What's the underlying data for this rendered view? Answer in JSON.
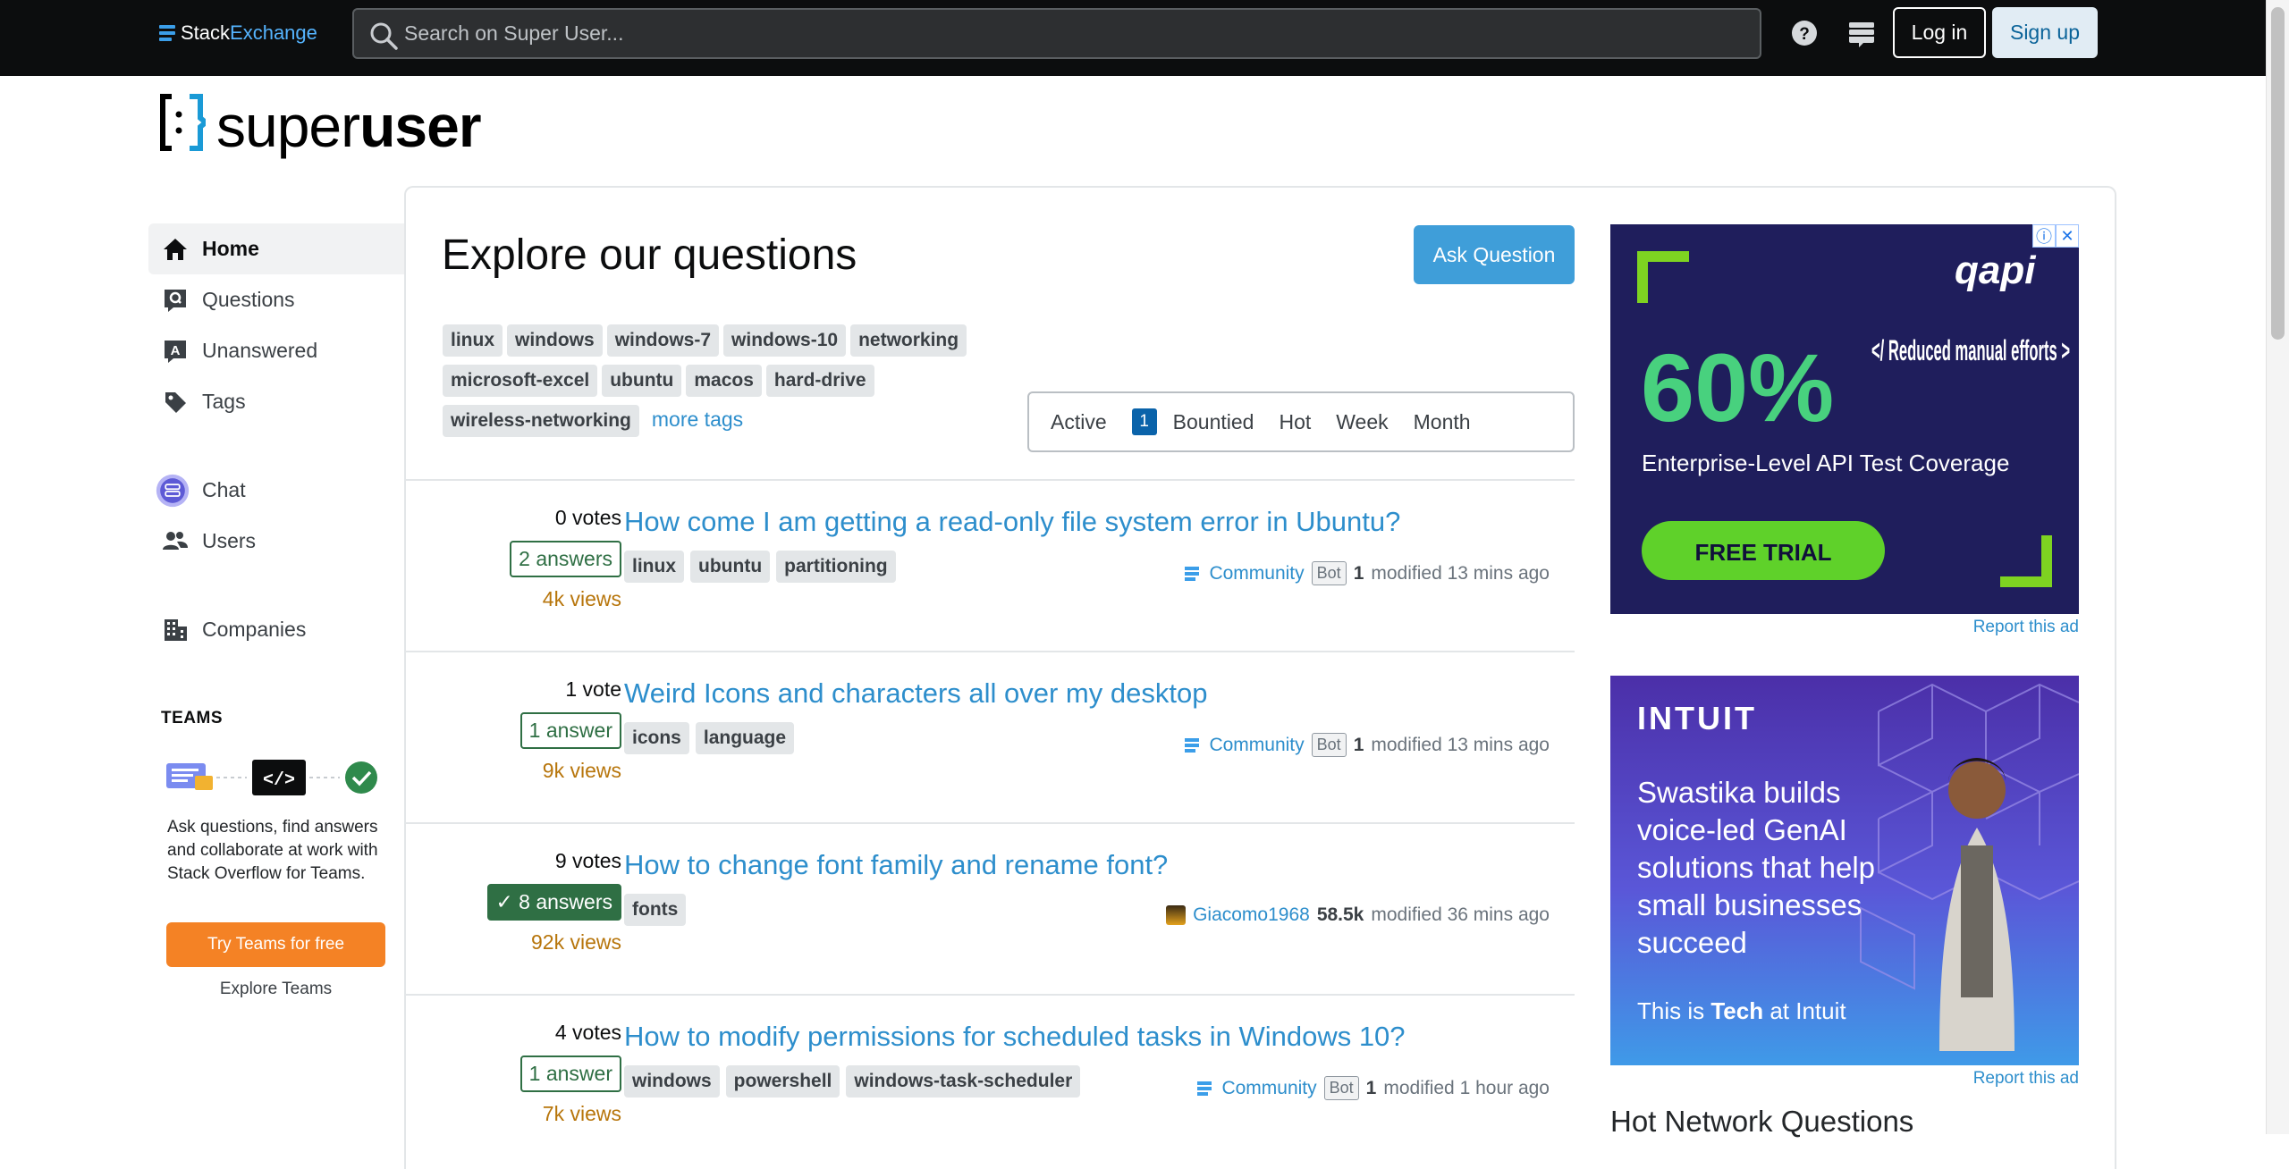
{
  "topbar": {
    "brand_a": "Stack",
    "brand_b": "Exchange",
    "search_placeholder": "Search on Super User...",
    "login_label": "Log in",
    "signup_label": "Sign up"
  },
  "site": {
    "logo_light": "super",
    "logo_bold": "user"
  },
  "sidebar": {
    "items": [
      {
        "label": "Home",
        "icon": "home-icon"
      },
      {
        "label": "Questions",
        "icon": "questions-icon"
      },
      {
        "label": "Unanswered",
        "icon": "unanswered-icon"
      },
      {
        "label": "Tags",
        "icon": "tags-icon"
      },
      {
        "label": "Chat",
        "icon": "chat-icon"
      },
      {
        "label": "Users",
        "icon": "users-icon"
      },
      {
        "label": "Companies",
        "icon": "companies-icon"
      }
    ],
    "teams_title": "TEAMS",
    "teams_desc": "Ask questions, find answers and collaborate at work with Stack Overflow for Teams.",
    "teams_button": "Try Teams for free",
    "teams_explore": "Explore Teams"
  },
  "main": {
    "title": "Explore our questions",
    "ask_button": "Ask Question",
    "tags": [
      "linux",
      "windows",
      "windows-7",
      "windows-10",
      "networking",
      "microsoft-excel",
      "ubuntu",
      "macos",
      "hard-drive",
      "wireless-networking"
    ],
    "more_tags": "more tags",
    "filters": {
      "active": "Active",
      "bounty_count": "1",
      "bountied": "Bountied",
      "hot": "Hot",
      "week": "Week",
      "month": "Month"
    },
    "questions": [
      {
        "votes": "0 votes",
        "answers": "2 answers",
        "views": "4k views",
        "title": "How come I am getting a read-only file system error in Ubuntu?",
        "tags": [
          "linux",
          "ubuntu",
          "partitioning"
        ],
        "user": "Community",
        "bot": "Bot",
        "rep": "1",
        "modified": "modified 13 mins ago"
      },
      {
        "votes": "1 vote",
        "answers": "1 answer",
        "views": "9k views",
        "title": "Weird Icons and characters all over my desktop",
        "tags": [
          "icons",
          "language"
        ],
        "user": "Community",
        "bot": "Bot",
        "rep": "1",
        "modified": "modified 13 mins ago"
      },
      {
        "votes": "9 votes",
        "answers": "8 answers",
        "views": "92k views",
        "title": "How to change font family and rename font?",
        "tags": [
          "fonts"
        ],
        "user": "Giacomo1968",
        "rep": "58.5k",
        "modified": "modified 36 mins ago"
      },
      {
        "votes": "4 votes",
        "answers": "1 answer",
        "views": "7k views",
        "title": "How to modify permissions for scheduled tasks in Windows 10?",
        "tags": [
          "windows",
          "powershell",
          "windows-task-scheduler"
        ],
        "user": "Community",
        "bot": "Bot",
        "rep": "1",
        "modified": "modified 1 hour ago"
      }
    ]
  },
  "rail": {
    "ad1": {
      "brand": "qapi",
      "big": "60%",
      "tagline": "</ Reduced manual efforts >",
      "subline": "Enterprise-Level API Test Coverage",
      "cta": "FREE TRIAL"
    },
    "report_label": "Report this ad",
    "ad2": {
      "brand": "INTUIT",
      "line1": "Swastika builds",
      "line2": "voice-led GenAI",
      "line3": "solutions that help",
      "line4": "small businesses",
      "line5": "succeed",
      "footer_a": "This is ",
      "footer_b": "Tech",
      "footer_c": " at Intuit"
    },
    "hot_title": "Hot Network Questions"
  },
  "colors": {
    "accent": "#3f9ed9",
    "link": "#2d8ecc",
    "accepted": "#2f6f44",
    "views": "#b7750b",
    "teams_orange": "#f48225"
  }
}
